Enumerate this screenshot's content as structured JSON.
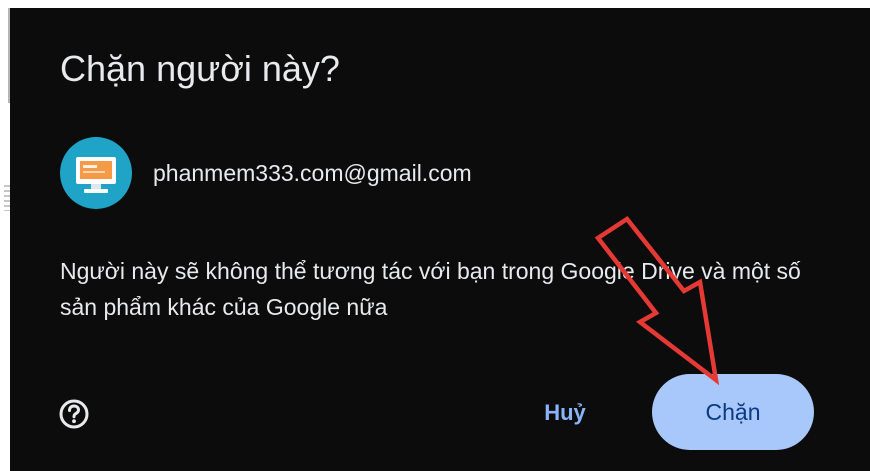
{
  "dialog": {
    "title": "Chặn người này?",
    "account": {
      "email": "phanmem333.com@gmail.com",
      "avatar_icon": "computer-monitor-icon"
    },
    "description": "Người này sẽ không thể tương tác với bạn trong Google Drive và một số sản phẩm khác của Google nữa",
    "help_icon": "help-circle-icon",
    "cancel_label": "Huỷ",
    "block_label": "Chặn"
  },
  "annotation": {
    "arrow_icon": "red-pointing-arrow",
    "arrow_color": "#e53935"
  },
  "colors": {
    "dialog_background": "#0c0c0c",
    "text": "#e8eaed",
    "accent_text": "#8ab4f8",
    "primary_button": "#a8c7fa",
    "primary_button_text": "#0b3a83",
    "avatar_background": "#1fa3c7"
  }
}
